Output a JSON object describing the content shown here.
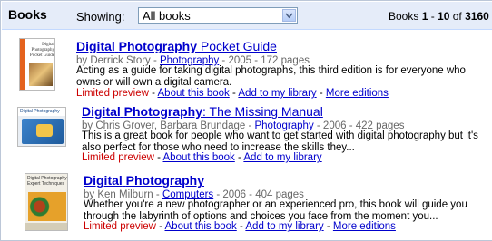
{
  "header": {
    "section_title": "Books",
    "showing_label": "Showing:",
    "filter_value": "All books",
    "results_prefix": "Books ",
    "range_start": "1",
    "range_sep": " - ",
    "range_end": "10",
    "of_label": " of ",
    "total": "3160"
  },
  "books": [
    {
      "title_bold1": "Digital",
      "title_bold2": "Photography",
      "title_rest": " Pocket Guide",
      "author_prefix": "by Derrick Story - ",
      "category": "Photography",
      "meta_suffix": " - 2005 - 172 pages",
      "description": "Acting as a guide for taking digital photographs, this third edition is for everyone who owns or will own a digital camera.",
      "status": "Limited preview",
      "links": [
        "About this book",
        "Add to my library",
        "More editions"
      ]
    },
    {
      "title_bold1": "Digital",
      "title_bold2": "Photography",
      "title_rest": ": The Missing Manual",
      "author_prefix": "by Chris Grover, Barbara Brundage - ",
      "category": "Photography",
      "meta_suffix": " - 2006 - 422 pages",
      "description": "This is a great book for people who want to get started with digital photography but it's also perfect for those who need to increase the skills they...",
      "status": "Limited preview",
      "links": [
        "About this book",
        "Add to my library"
      ]
    },
    {
      "title_bold1": "Digital",
      "title_bold2": "Photography",
      "title_rest": "",
      "author_prefix": "by Ken Milburn - ",
      "category": "Computers",
      "meta_suffix": " - 2006 - 404 pages",
      "description": "Whether you're a new photographer or an experienced pro, this book will guide you through the labyrinth of options and choices you face from the moment you...",
      "status": "Limited preview",
      "links": [
        "About this book",
        "Add to my library",
        "More editions"
      ]
    }
  ],
  "covers": [
    {
      "text": "Digital Photography Pocket Guide",
      "color": "#d9611c"
    },
    {
      "text": "Digital Photography",
      "color": "#2a6fb5"
    },
    {
      "text": "Digital Photography Expert Techniques",
      "color": "#e07a1d"
    }
  ],
  "colors": {
    "link": "#0000cc",
    "preview": "#cc0000",
    "meta": "#676767",
    "header_bg": "#e5ecf9"
  }
}
